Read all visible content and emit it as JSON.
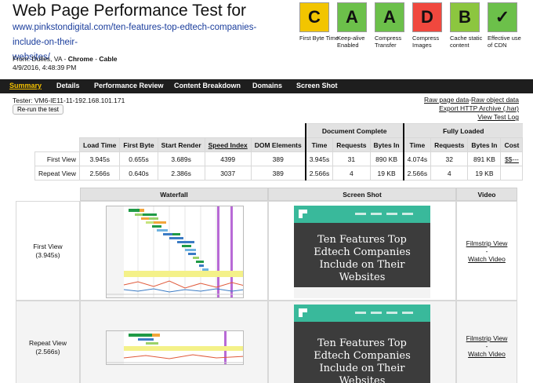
{
  "header": {
    "title": "Web Page Performance Test for",
    "url_line1": "www.pinkstondigital.com/ten-features-top-edtech-companies-include-on-their-",
    "url_line2": "websites/",
    "from_prefix": "From: Dulles, VA - ",
    "from_browser": "Chrome",
    "from_sep": " - ",
    "from_conn": "Cable",
    "date": "4/9/2016, 4:48:39 PM"
  },
  "grades": [
    {
      "letter": "C",
      "caption": "First Byte Time",
      "color": "#f2c500"
    },
    {
      "letter": "A",
      "caption": "Keep-alive Enabled",
      "color": "#6cc04a"
    },
    {
      "letter": "A",
      "caption": "Compress Transfer",
      "color": "#6cc04a"
    },
    {
      "letter": "D",
      "caption": "Compress Images",
      "color": "#f0483e"
    },
    {
      "letter": "B",
      "caption": "Cache static content",
      "color": "#8cc63f"
    },
    {
      "letter": "✓",
      "caption": "Effective use of CDN",
      "color": "#6cc04a"
    }
  ],
  "nav": [
    "Summary",
    "Details",
    "Performance Review",
    "Content Breakdown",
    "Domains",
    "Screen Shot"
  ],
  "tester": "Tester: VM6-IE11-11-192.168.101.171",
  "rerun_label": "Re-run the test",
  "right_links": [
    "Raw page data",
    " - ",
    "Raw object data",
    "Export HTTP Archive (.har)",
    "View Test Log"
  ],
  "results": {
    "group_doc": "Document Complete",
    "group_full": "Fully Loaded",
    "headers": [
      "Load Time",
      "First Byte",
      "Start Render",
      "Speed Index",
      "DOM Elements",
      "Time",
      "Requests",
      "Bytes In",
      "Time",
      "Requests",
      "Bytes In",
      "Cost"
    ],
    "rows": [
      {
        "label": "First View",
        "cells": [
          "3.945s",
          "0.655s",
          "3.689s",
          "4399",
          "389",
          "3.945s",
          "31",
          "890 KB",
          "4.074s",
          "32",
          "891 KB",
          "$$---"
        ]
      },
      {
        "label": "Repeat View",
        "cells": [
          "2.566s",
          "0.640s",
          "2.386s",
          "3037",
          "389",
          "2.566s",
          "4",
          "19 KB",
          "2.566s",
          "4",
          "19 KB",
          ""
        ]
      }
    ]
  },
  "views": {
    "headers": [
      "Waterfall",
      "Screen Shot",
      "Video"
    ],
    "first": {
      "label": "First View",
      "time": "(3.945s)"
    },
    "repeat": {
      "label": "Repeat View",
      "time": "(2.566s)"
    },
    "filmstrip": "Filmstrip View",
    "dash": "-",
    "watch": "Watch Video",
    "shot_headline_1": "Ten Features Top Edtech Companies Include on Their Websites",
    "shot_headline_2": "Ten Features Top Edtech Companies Include on Their Websites"
  }
}
